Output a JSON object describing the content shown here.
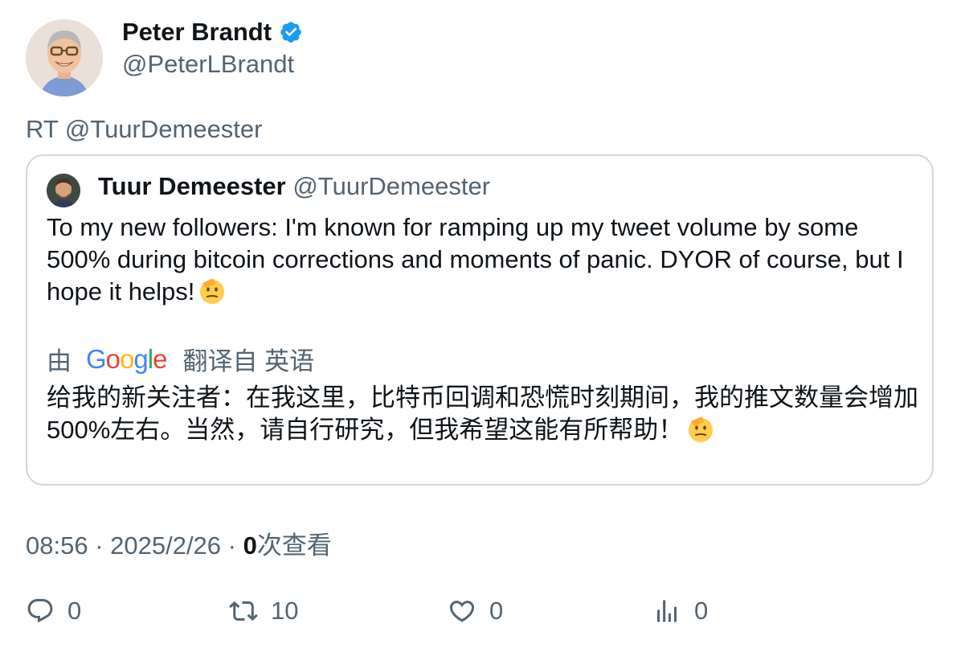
{
  "author": {
    "display_name": "Peter Brandt",
    "handle": "@PeterLBrandt",
    "verified_icon": "verified-badge-icon"
  },
  "retweet_line": "RT @TuurDemeester",
  "quoted": {
    "display_name": "Tuur Demeester",
    "handle": "@TuurDemeester",
    "text": "To my new followers: I'm known for ramping up my tweet volume by some 500% during bitcoin corrections and moments of panic. DYOR of course, but I hope it helps!",
    "translation_prefix": "由",
    "translation_logo": "Google",
    "translation_suffix": "翻译自 英语",
    "translated_text": "给我的新关注者：在我这里，比特币回调和恐慌时刻期间，我的推文数量会增加500%左右。当然，请自行研究，但我希望这能有所帮助！"
  },
  "meta": {
    "time_date": "08:56 · 2025/2/26 · ",
    "views_count": "0",
    "views_label": "次查看"
  },
  "actions": {
    "replies": "0",
    "retweets": "10",
    "likes": "0",
    "views": "0"
  },
  "colors": {
    "verified": "#1d9bf0",
    "secondary_text": "#536471",
    "primary_text": "#0f1419",
    "card_border": "#cfd9de"
  }
}
